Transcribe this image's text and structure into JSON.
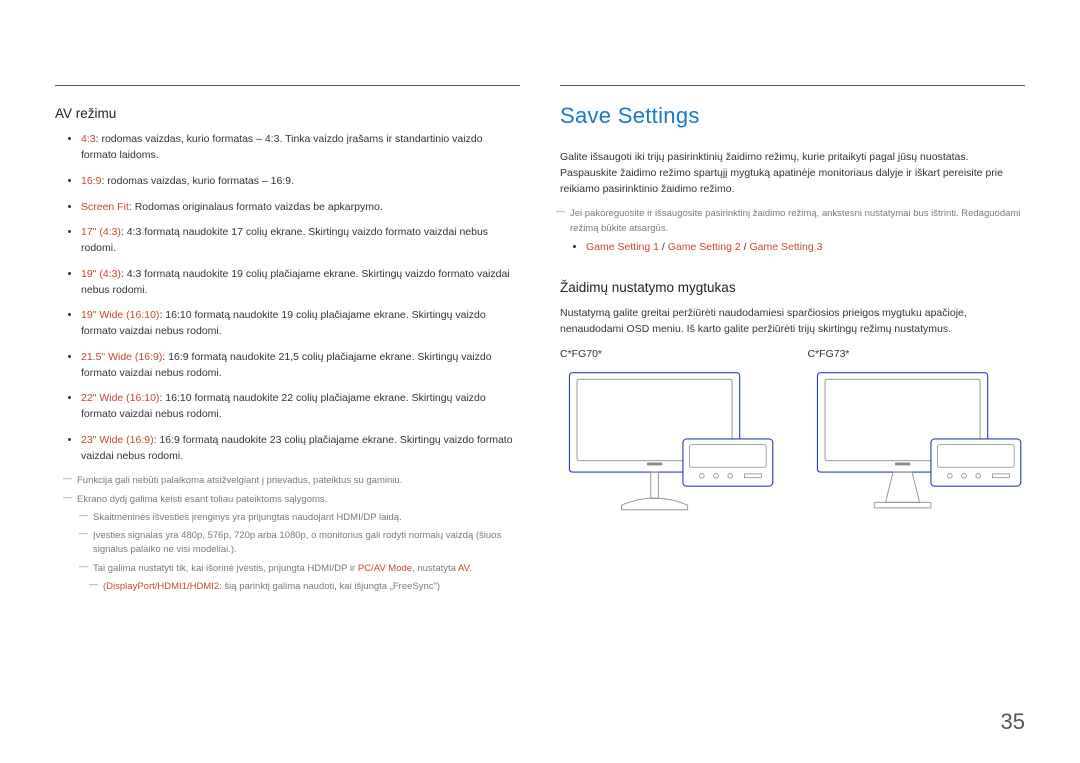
{
  "left": {
    "heading": "AV režimu",
    "bullets": [
      {
        "redLead": "4:3",
        "text": ": rodomas vaizdas, kurio formatas – 4:3. Tinka vaizdo įrašams ir standartinio vaizdo formato laidoms."
      },
      {
        "redLead": "16:9",
        "text": ": rodomas vaizdas, kurio formatas – 16:9."
      },
      {
        "redLead": "Screen Fit",
        "text": ": Rodomas originalaus formato vaizdas be apkarpymo."
      },
      {
        "redLead": "17\" (4:3)",
        "text": ": 4:3 formatą naudokite 17 colių ekrane. Skirtingų vaizdo formato vaizdai nebus rodomi."
      },
      {
        "redLead": "19\" (4:3)",
        "text": ": 4:3 formatą naudokite 19 colių plačiajame ekrane. Skirtingų vaizdo formato vaizdai nebus rodomi."
      },
      {
        "redLead": "19\" Wide (16:10)",
        "text": ": 16:10 formatą naudokite 19 colių plačiajame ekrane. Skirtingų vaizdo formato vaizdai nebus rodomi."
      },
      {
        "redLead": "21.5\" Wide (16:9)",
        "text": ": 16:9 formatą naudokite 21,5 colių plačiajame ekrane. Skirtingų vaizdo formato vaizdai nebus rodomi."
      },
      {
        "redLead": "22\" Wide (16:10)",
        "text": ": 16:10 formatą naudokite 22 colių plačiajame ekrane. Skirtingų vaizdo formato vaizdai nebus rodomi."
      },
      {
        "redLead": "23\" Wide (16:9)",
        "text": ": 16:9 formatą naudokite 23 colių plačiajame ekrane. Skirtingų vaizdo formato vaizdai nebus rodomi."
      }
    ],
    "notes": {
      "n1": "Funkcija gali nebūti palaikoma atsižvelgiant į prievadus, pateiktus su gaminiu.",
      "n2": "Ekrano dydį galima keisti esant toliau pateiktoms sąlygoms.",
      "n2a": "Skaitmeninės išvesties įrenginys yra prijungtas naudojant HDMI/DP laidą.",
      "n2b": "Įvesties signalas yra 480p, 576p, 720p arba 1080p, o monitorius gali rodyti normalų vaizdą (šiuos signalus palaiko ne visi modeliai.).",
      "n2c_pre": "Tai galima nustatyti tik, kai išorinė įvestis, prijungta HDMI/DP ir ",
      "n2c_red1": "PC/AV Mode",
      "n2c_mid": ", nustatyta ",
      "n2c_red2": "AV",
      "n2c_end": ".",
      "n2d_pre": "(",
      "n2d_red": "DisplayPort/HDMI1/HDMI2",
      "n2d_post": ": šią parinktį galima naudoti, kai išjungta „FreeSync\")"
    }
  },
  "right": {
    "heading_blue": "Save Settings",
    "para1": "Galite išsaugoti iki trijų pasirinktinių žaidimo režimų, kurie pritaikyti pagal jūsų nuostatas. Paspauskite žaidimo režimo spartųjį mygtuką apatinėje monitoriaus dalyje ir iškart pereisite prie reikiamo pasirinktinio žaidimo režimo.",
    "note1": "Jei pakoreguosite ir išsaugosite pasirinktinį žaidimo režimą, ankstesni nustatymai bus ištrinti. Redaguodami režimą būkite atsargūs.",
    "gs1": "Game Setting 1",
    "sep": " / ",
    "gs2": "Game Setting 2",
    "gs3": "Game Setting 3",
    "heading_black": "Žaidimų nustatymo mygtukas",
    "para2": "Nustatymą galite greitai peržiūrėti naudodamiesi sparčiosios prieigos mygtuku apačioje, nenaudodami OSD meniu. Iš karto galite peržiūrėti trijų skirtingų režimų nustatymus.",
    "mon1_label": "C*FG70*",
    "mon2_label": "C*FG73*"
  },
  "pageNumber": "35"
}
